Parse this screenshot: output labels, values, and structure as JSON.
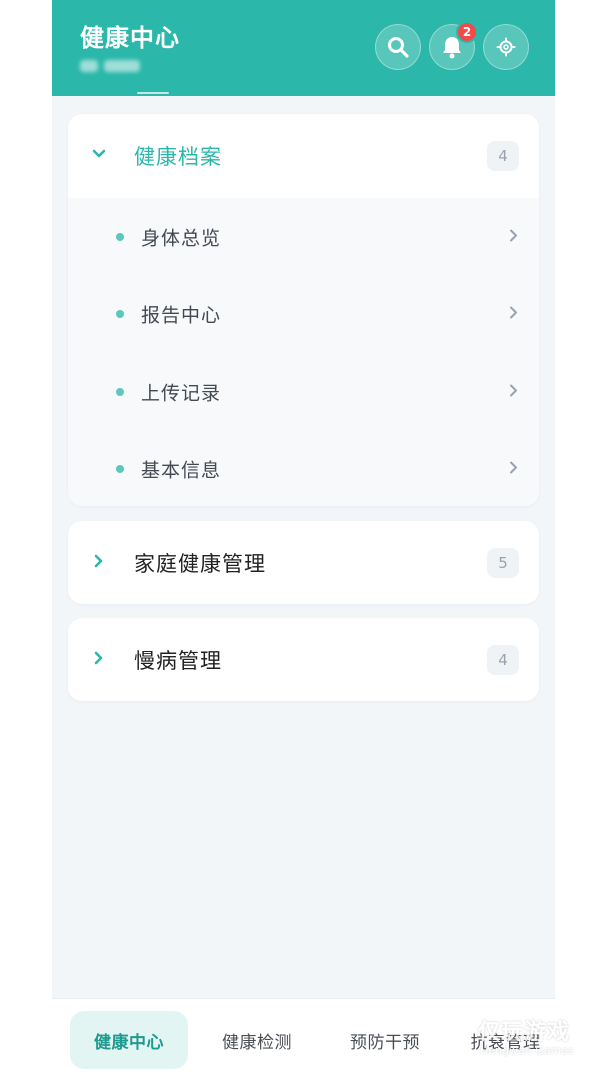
{
  "header": {
    "title": "健康中心",
    "notification_count": "2",
    "icons": [
      "search-icon",
      "bell-icon",
      "gear-icon"
    ]
  },
  "menu": [
    {
      "title": "健康档案",
      "count": "4",
      "expanded": true,
      "items": [
        {
          "label": "身体总览"
        },
        {
          "label": "报告中心"
        },
        {
          "label": "上传记录"
        },
        {
          "label": "基本信息"
        }
      ]
    },
    {
      "title": "家庭健康管理",
      "count": "5",
      "expanded": false
    },
    {
      "title": "慢病管理",
      "count": "4",
      "expanded": false
    }
  ],
  "bottom_nav": {
    "items": [
      {
        "label": "健康中心",
        "active": true
      },
      {
        "label": "健康检测",
        "active": false
      },
      {
        "label": "预防干预",
        "active": false
      },
      {
        "label": "抗衰管理",
        "active": false
      }
    ]
  },
  "watermark": {
    "title": "仅玩游戏",
    "subtitle": "Hengwan Games"
  },
  "colors": {
    "accent": "#2bb7aa",
    "background": "#f2f6f9",
    "badge": "#f04a4a"
  }
}
